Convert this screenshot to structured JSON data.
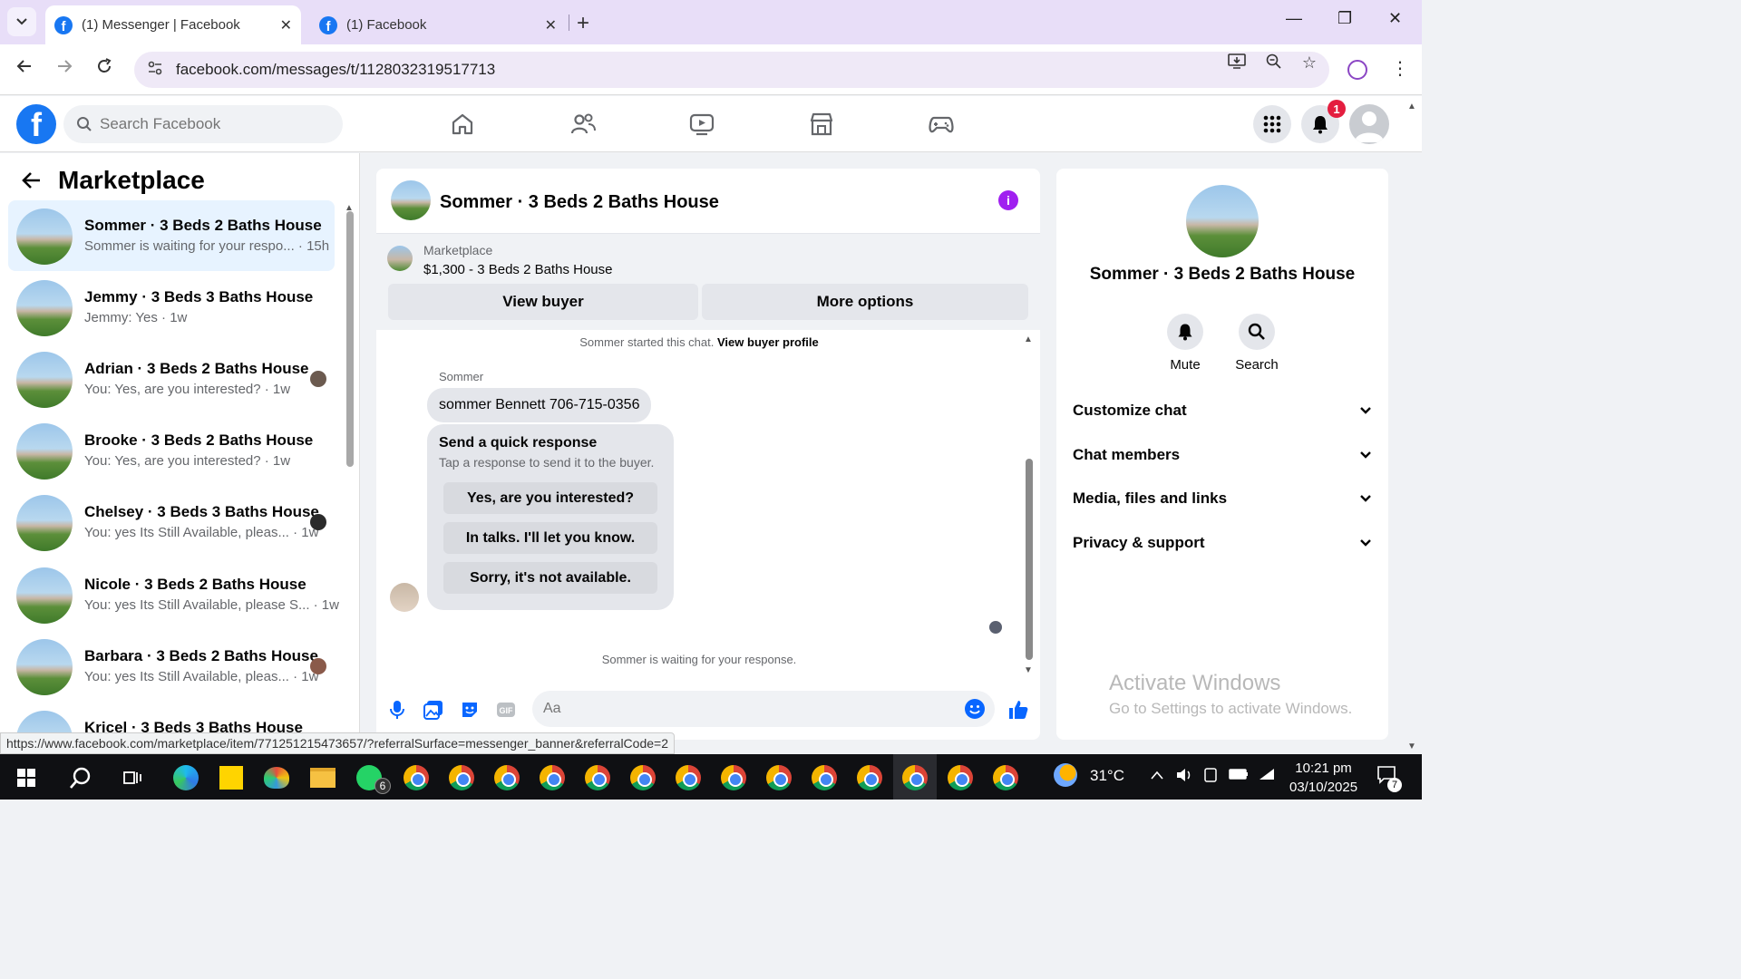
{
  "browser": {
    "tabs": [
      {
        "title": "(1) Messenger | Facebook",
        "active": true
      },
      {
        "title": "(1) Facebook",
        "active": false
      }
    ],
    "url": "facebook.com/messages/t/1128032319517713",
    "status_url": "https://www.facebook.com/marketplace/item/771251215473657/?referralSurface=messenger_banner&referralCode=2"
  },
  "fb": {
    "search_placeholder": "Search Facebook",
    "notification_count": "1"
  },
  "sidebar": {
    "title": "Marketplace",
    "conversations": [
      {
        "title": "Sommer · 3 Beds 2 Baths House",
        "sub": "Sommer is waiting for your respo... · 15h",
        "active": true
      },
      {
        "title": "Jemmy · 3 Beds 3 Baths House",
        "sub": "Jemmy: Yes · 1w"
      },
      {
        "title": "Adrian · 3 Beds 2 Baths House",
        "sub": "You: Yes, are you interested? · 1w"
      },
      {
        "title": "Brooke · 3 Beds 2 Baths House",
        "sub": "You: Yes, are you interested? · 1w"
      },
      {
        "title": "Chelsey · 3 Beds 3 Baths House",
        "sub": "You: yes Its Still Available, pleas... · 1w"
      },
      {
        "title": "Nicole · 3 Beds 2 Baths House",
        "sub": "You: yes Its Still Available, please S... · 1w"
      },
      {
        "title": "Barbara · 3 Beds 2 Baths House",
        "sub": "You: yes Its Still Available, pleas... · 1w"
      },
      {
        "title": "Kricel · 3 Beds 3 Baths House",
        "sub": ""
      }
    ]
  },
  "chat": {
    "title": "Sommer · 3 Beds 2 Baths House",
    "banner": {
      "label": "Marketplace",
      "price_title": "$1,300 - 3 Beds 2 Baths House",
      "view_buyer": "View buyer",
      "more_options": "More options"
    },
    "started_text": "Sommer started this chat.",
    "view_buyer_profile": "View buyer profile",
    "sender_name": "Sommer",
    "message": "sommer Bennett 706-715-0356",
    "quick": {
      "title": "Send a quick response",
      "subtitle": "Tap a response to send it to the buyer.",
      "options": [
        "Yes, are you interested?",
        "In talks. I'll let you know.",
        "Sorry, it's not available."
      ]
    },
    "waiting": "Sommer is waiting for your response.",
    "composer_placeholder": "Aa"
  },
  "rpanel": {
    "title": "Sommer · 3 Beds 2 Baths House",
    "mute": "Mute",
    "search": "Search",
    "rows": [
      "Customize chat",
      "Chat members",
      "Media, files and links",
      "Privacy & support"
    ],
    "activate_1": "Activate Windows",
    "activate_2": "Go to Settings to activate Windows."
  },
  "taskbar": {
    "temperature": "31°C",
    "time": "10:21 pm",
    "date": "03/10/2025",
    "whatsapp_badge": "6",
    "notif_count": "7"
  }
}
